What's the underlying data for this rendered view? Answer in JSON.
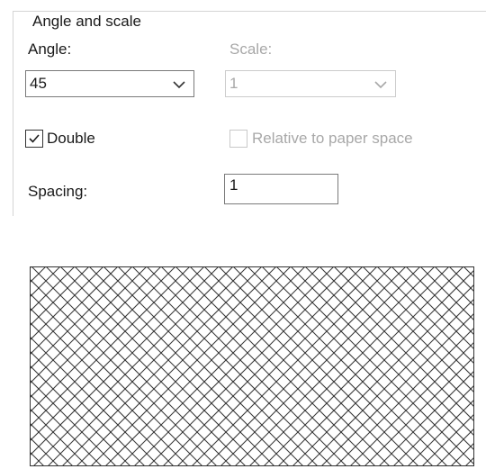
{
  "group": {
    "title": "Angle and scale"
  },
  "angle": {
    "label": "Angle:",
    "value": "45"
  },
  "scale": {
    "label": "Scale:",
    "value": "1",
    "enabled": false
  },
  "double": {
    "label": "Double",
    "checked": true
  },
  "relative_to_paper_space": {
    "label": "Relative to paper space",
    "checked": false,
    "enabled": false
  },
  "spacing": {
    "label": "Spacing:",
    "value": "1"
  },
  "preview": {
    "pattern": "crosshatch",
    "hatch_angles_degrees": [
      45,
      135
    ]
  },
  "colors": {
    "text": "#1a1a1a",
    "disabled_text": "#a8a8a8",
    "border": "#7a7a7a",
    "hatch_line": "#333333"
  }
}
